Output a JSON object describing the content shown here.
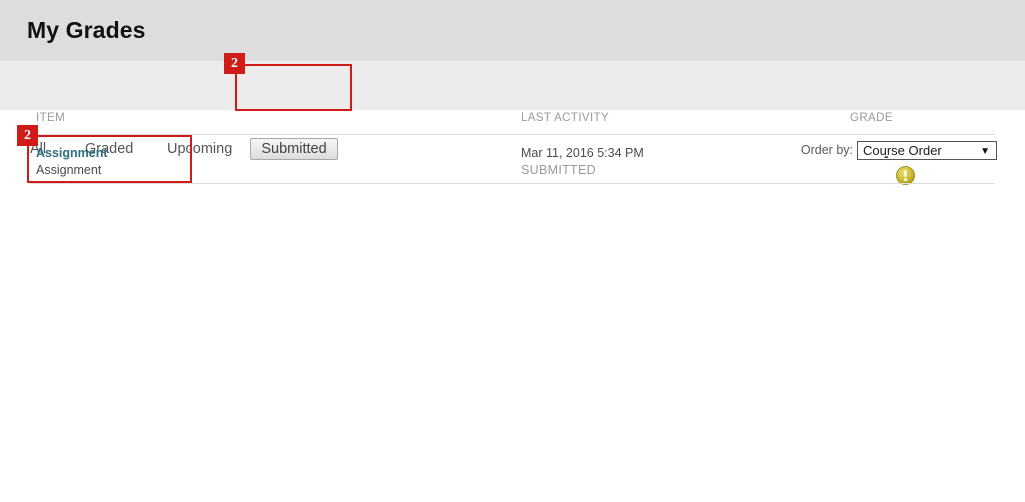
{
  "header": {
    "title": "My Grades"
  },
  "tabbar": {
    "tabs": [
      {
        "label": "All",
        "selected": false
      },
      {
        "label": "Graded",
        "selected": false
      },
      {
        "label": "Upcoming",
        "selected": false
      },
      {
        "label": "Submitted",
        "selected": true
      }
    ],
    "order_by_label": "Order by:",
    "order_by_value": "Course Order",
    "order_by_options": [
      "Course Order"
    ],
    "dropdown_arrow": "▼"
  },
  "table": {
    "columns": [
      "ITEM",
      "LAST ACTIVITY",
      "GRADE"
    ],
    "rows": [
      {
        "item_title": "Assignment",
        "item_subtitle": "Assignment",
        "last_activity_date": "Mar 11, 2016 5:34 PM",
        "last_activity_status": "SUBMITTED",
        "grade": "-",
        "grade_icon": "exclamation-needs-grading-icon"
      }
    ]
  },
  "annotations": [
    {
      "badge": "2",
      "target": "submitted-tab"
    },
    {
      "badge": "2",
      "target": "assignment-item-cell"
    }
  ],
  "colors": {
    "header_bg": "#dddddd",
    "tabbar_bg": "#ececec",
    "link": "#2e6e7e",
    "annotation": "#d01c18",
    "grade_icon": "#c6b52a"
  }
}
